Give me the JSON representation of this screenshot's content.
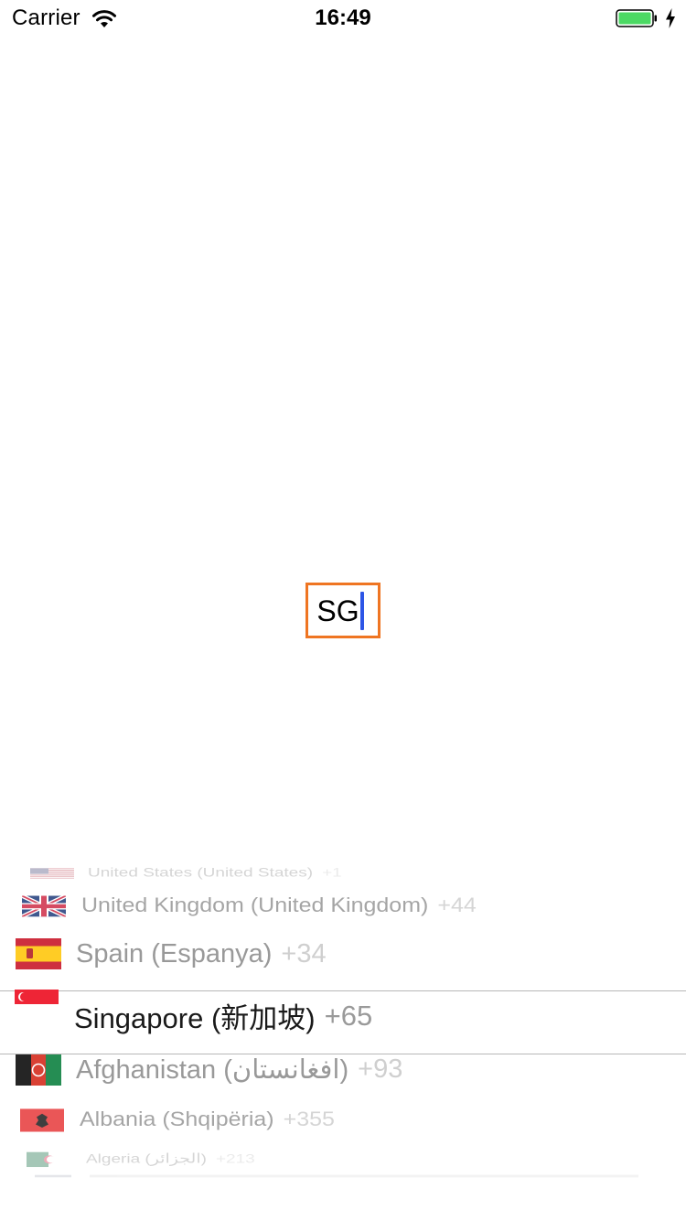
{
  "status_bar": {
    "carrier": "Carrier",
    "time": "16:49",
    "icons": [
      "wifi-icon",
      "battery-icon",
      "charging-bolt-icon"
    ],
    "battery_color": "#4cd964"
  },
  "code_field": {
    "value": "SG",
    "border_color": "#ef7522",
    "caret_color": "#2d55e6"
  },
  "picker": {
    "selected_index": 3,
    "rows": [
      {
        "name": "United States (United States)",
        "code": "+1",
        "flag": "us-flag-icon"
      },
      {
        "name": "United Kingdom (United Kingdom)",
        "code": "+44",
        "flag": "uk-flag-icon"
      },
      {
        "name": "Spain (Espanya)",
        "code": "+34",
        "flag": "spain-flag-icon"
      },
      {
        "name": "Singapore (新加坡)",
        "code": "+65",
        "flag": "singapore-flag-icon"
      },
      {
        "name": "Afghanistan (افغانستان)",
        "code": "+93",
        "flag": "afghanistan-flag-icon"
      },
      {
        "name": "Albania (Shqipëria)",
        "code": "+355",
        "flag": "albania-flag-icon"
      },
      {
        "name": "Algeria (الجزائر)",
        "code": "+213",
        "flag": "algeria-flag-icon"
      }
    ]
  }
}
